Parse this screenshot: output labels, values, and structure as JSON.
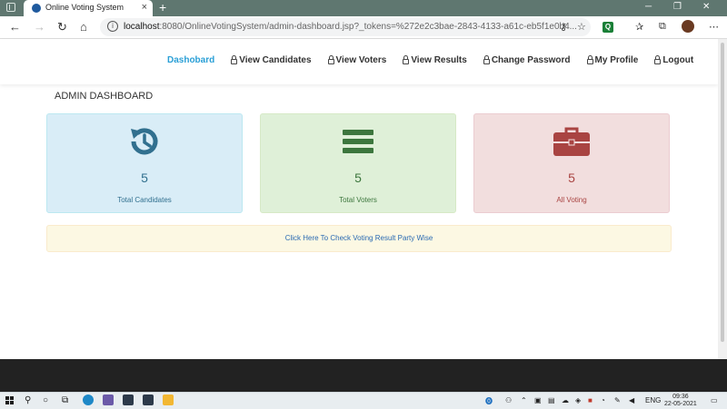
{
  "browser": {
    "tab_title": "Online Voting System",
    "url_host": "localhost",
    "url_rest": ":8080/OnlineVotingSystem/admin-dashboard.jsp?_tokens=%272e2c3bae-2843-4133-a61c-eb5f1e0b4..."
  },
  "nav": {
    "links": [
      {
        "label": "Dashobard",
        "active": true
      },
      {
        "label": "View Candidates"
      },
      {
        "label": "View Voters"
      },
      {
        "label": "View Results"
      },
      {
        "label": "Change Password"
      },
      {
        "label": "My Profile"
      },
      {
        "label": "Logout"
      }
    ]
  },
  "page": {
    "heading": "ADMIN DASHBOARD",
    "cards": [
      {
        "value": "5",
        "label": "Total Candidates",
        "icon": "history-icon",
        "color": "#31708f"
      },
      {
        "value": "5",
        "label": "Total Voters",
        "icon": "list-icon",
        "color": "#3c763d"
      },
      {
        "value": "5",
        "label": "All Voting",
        "icon": "briefcase-icon",
        "color": "#a94442"
      }
    ],
    "result_link": "Click Here To Check Voting Result Party Wise"
  },
  "taskbar": {
    "lang": "ENG",
    "time": "09:36",
    "date": "22-05-2021"
  }
}
